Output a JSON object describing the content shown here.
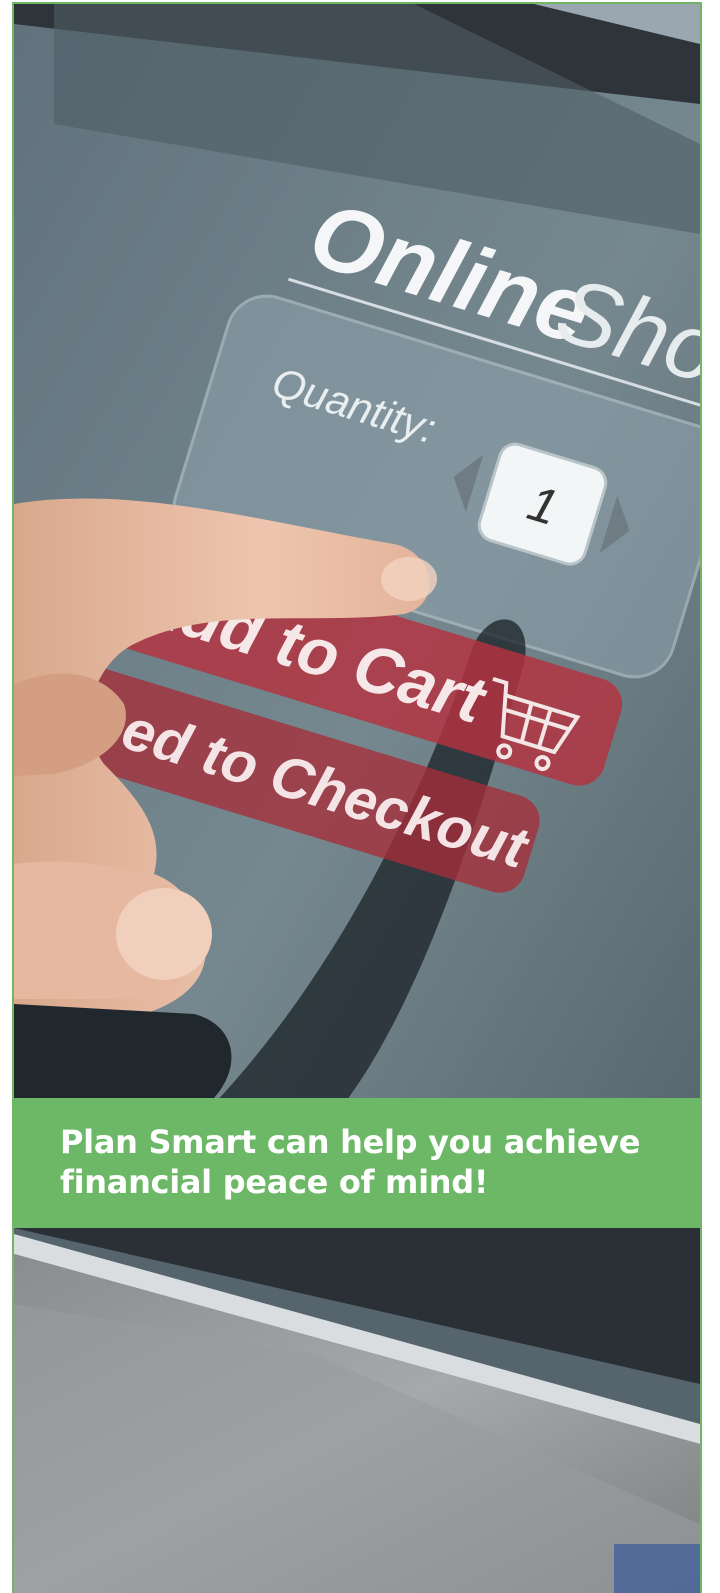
{
  "screen": {
    "title_bold": "Online",
    "title_light": "Sho",
    "quantity_label": "Quantity:",
    "quantity_value": "1",
    "add_to_cart_label": "Add to Cart",
    "checkout_label": "ceed to Checkout"
  },
  "banner": {
    "line1": "Plan Smart can help you achieve",
    "line2": "financial peace of mind!"
  },
  "colors": {
    "accent_green": "#6cb867",
    "button_red": "#b5323f"
  },
  "icons": [
    "shopping-cart-icon",
    "decrement-arrow-icon",
    "increment-arrow-icon"
  ]
}
